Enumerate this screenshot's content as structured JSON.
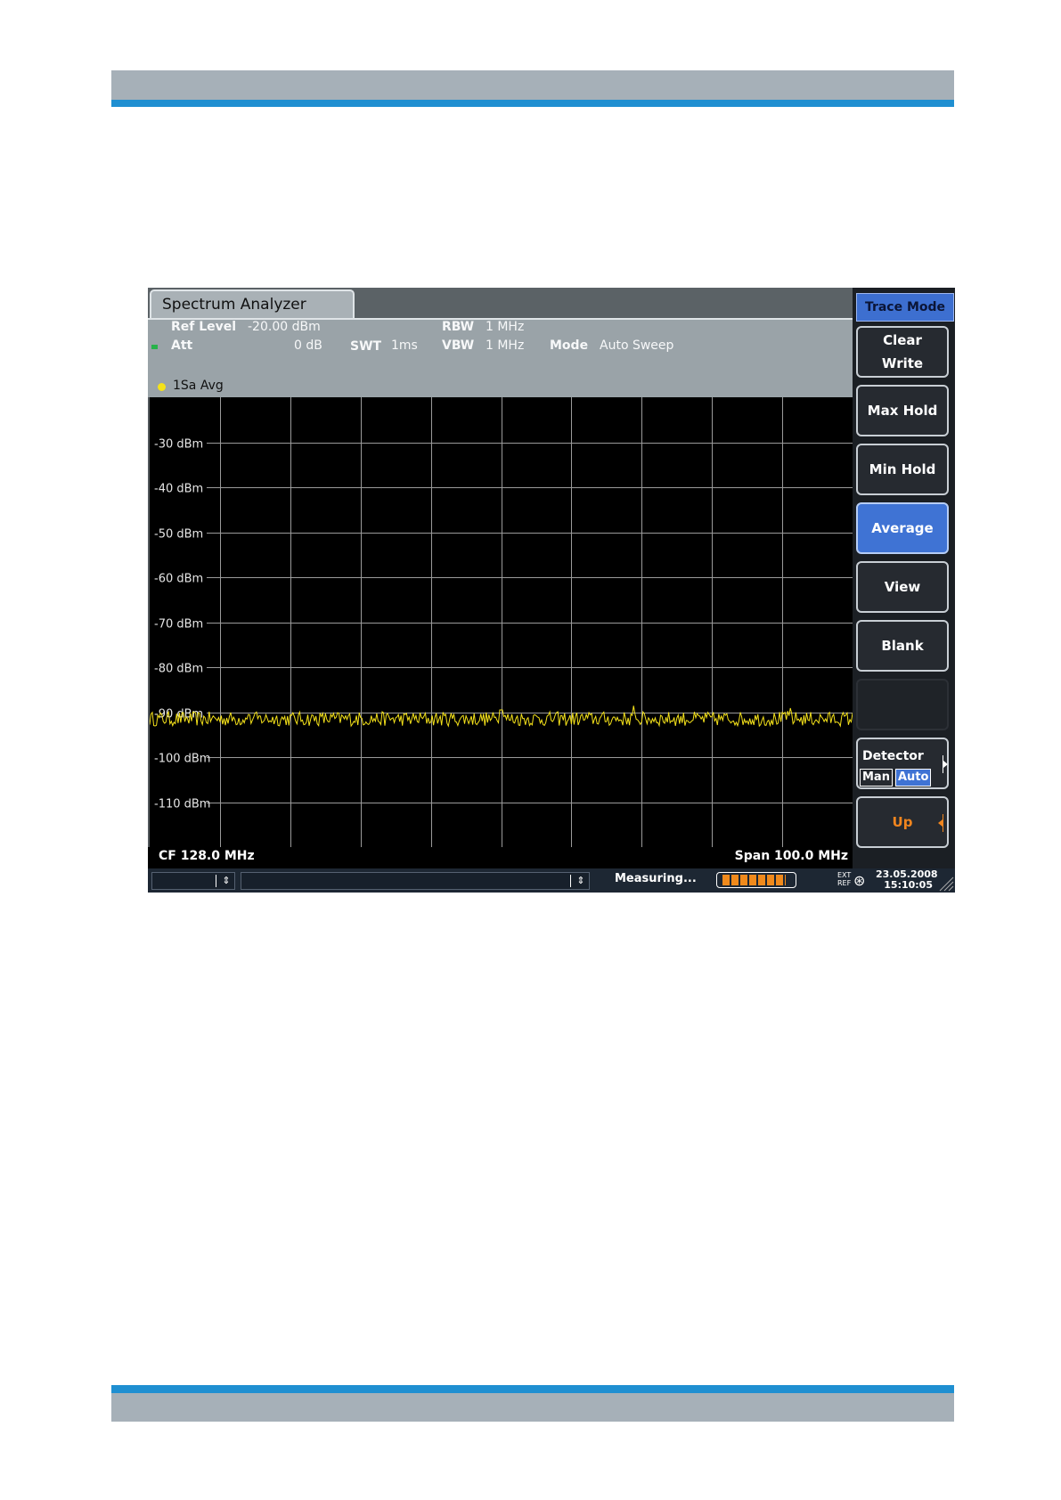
{
  "instrument": {
    "title": "Spectrum Analyzer",
    "ref_level_label": "Ref Level",
    "ref_level_value": "-20.00 dBm",
    "att_label": "Att",
    "att_value": "0 dB",
    "swt_label": "SWT",
    "swt_value": "1ms",
    "rbw_label": "RBW",
    "rbw_value": "1 MHz",
    "vbw_label": "VBW",
    "vbw_value": "1 MHz",
    "mode_label": "Mode",
    "mode_value": "Auto Sweep",
    "trace_label": "1Sa Avg",
    "center_freq": "CF 128.0 MHz",
    "span": "Span 100.0 MHz"
  },
  "softkeys": {
    "menu_title": "Trace Mode",
    "clear_write": "Clear\nWrite",
    "max_hold": "Max Hold",
    "min_hold": "Min Hold",
    "average": "Average",
    "view": "View",
    "blank": "Blank",
    "detector": "Detector",
    "detector_man": "Man",
    "detector_auto": "Auto",
    "up": "Up"
  },
  "status": {
    "measuring": "Measuring...",
    "progress": 0.85,
    "ext_ref": "EXT\nREF",
    "date": "23.05.2008",
    "time": "15:10:05"
  },
  "colors": {
    "trace": "#f5e21a",
    "active_softkey": "#3f73d4",
    "up_softkey_text": "#f0851e",
    "accent_stripe": "#1f8fd1"
  },
  "chart_data": {
    "type": "line",
    "y_ticks": [
      "-30 dBm",
      "-40 dBm",
      "-50 dBm",
      "-60 dBm",
      "-70 dBm",
      "-80 dBm",
      "-90 dBm",
      "-100 dBm",
      "-110 dBm"
    ],
    "y_range_dbm": [
      -20,
      -120
    ],
    "x_range_mhz": [
      78,
      178
    ],
    "x_divisions": 10,
    "y_divisions": 10,
    "noise_floor_dbm": -91.5,
    "noise_peak_dbm": -89.5,
    "grid": true
  }
}
